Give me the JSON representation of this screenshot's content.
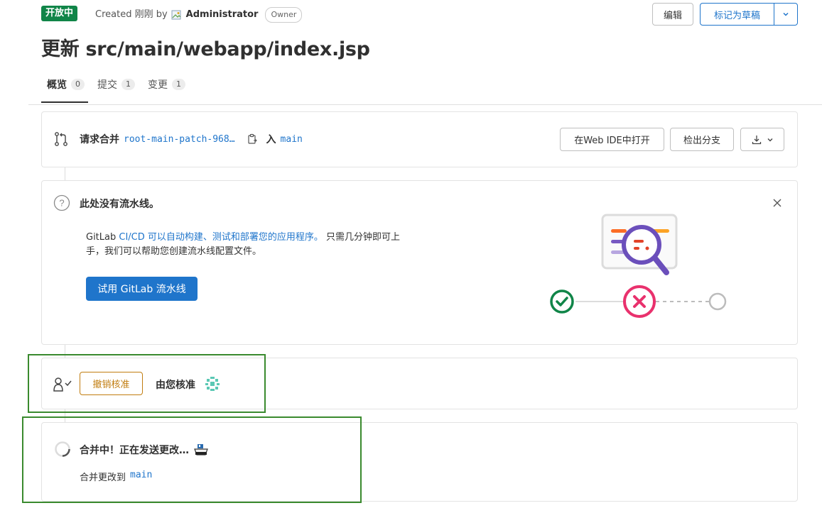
{
  "header": {
    "status": "开放中",
    "created_text": "Created 刚刚 by",
    "author": "Administrator",
    "role": "Owner",
    "edit_label": "编辑",
    "draft_label": "标记为草稿"
  },
  "title": "更新 src/main/webapp/index.jsp",
  "tabs": [
    {
      "label": "概览",
      "count": "0"
    },
    {
      "label": "提交",
      "count": "1"
    },
    {
      "label": "变更",
      "count": "1"
    }
  ],
  "merge": {
    "prefix": "请求合并",
    "source_branch": "root-main-patch-968…",
    "into": "入",
    "target_branch": "main",
    "open_ide_label": "在Web IDE中打开",
    "checkout_label": "检出分支"
  },
  "pipeline": {
    "title": "此处没有流水线。",
    "desc_pre": "GitLab ",
    "desc_link": "CI/CD 可以自动构建、测试和部署您的应用程序。",
    "desc_post": " 只需几分钟即可上",
    "desc_line2": "手，我们可以帮助您创建流水线配置文件。",
    "try_label": "试用 GitLab 流水线"
  },
  "approval": {
    "revoke_label": "撤销核准",
    "approved_by_label": "由您核准"
  },
  "merging": {
    "title": "合并中！正在发送更改…",
    "desc_pre": "合并更改到",
    "target_branch": "main"
  },
  "colors": {
    "accent": "#1f75cb",
    "success": "#108548",
    "danger": "#dd2b0e",
    "warning": "#c17d10"
  }
}
